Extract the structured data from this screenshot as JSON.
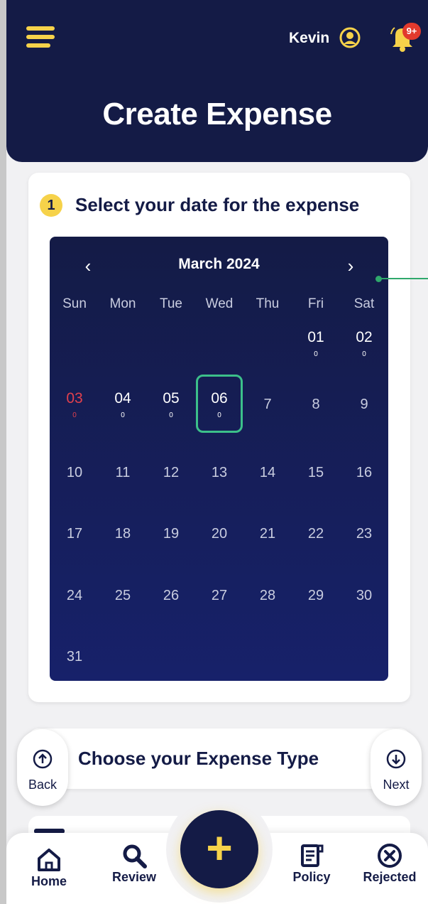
{
  "header": {
    "title": "Create Expense",
    "user_name": "Kevin",
    "notification_count": "9+",
    "icons": {
      "menu": "hamburger-icon",
      "user": "user-circle-icon",
      "notifications": "bell-icon"
    }
  },
  "step1": {
    "number": "1",
    "label": "Select your date for the expense"
  },
  "calendar": {
    "month_label": "March 2024",
    "prev_label": "‹",
    "next_label": "›",
    "weekdays": [
      "Sun",
      "Mon",
      "Tue",
      "Wed",
      "Thu",
      "Fri",
      "Sat"
    ],
    "days": [
      "01",
      "02",
      "03",
      "04",
      "05",
      "06",
      "7",
      "8",
      "9",
      "10",
      "11",
      "12",
      "13",
      "14",
      "15",
      "16",
      "17",
      "18",
      "19",
      "20",
      "21",
      "22",
      "23",
      "24",
      "25",
      "26",
      "27",
      "28",
      "29",
      "30",
      "31"
    ],
    "day_counts": {
      "01": "0",
      "02": "0",
      "03": "0",
      "04": "0",
      "05": "0",
      "06": "0"
    },
    "selected_day": "06"
  },
  "step2": {
    "label": "Choose your Expense Type",
    "back_label": "Back",
    "next_label": "Next"
  },
  "fab": {
    "label": "+"
  },
  "bottom_nav": [
    {
      "label": "Home",
      "icon": "home-icon"
    },
    {
      "label": "Review",
      "icon": "search-icon"
    },
    {
      "label": "Policy",
      "icon": "policy-document-icon"
    },
    {
      "label": "Rejected",
      "icon": "close-circle-icon"
    }
  ],
  "colors": {
    "navy": "#141b46",
    "accent_yellow": "#f6d24a",
    "selected_green": "#3cc08a",
    "sunday_red": "#e0404d",
    "badge_red": "#e23a2d"
  }
}
